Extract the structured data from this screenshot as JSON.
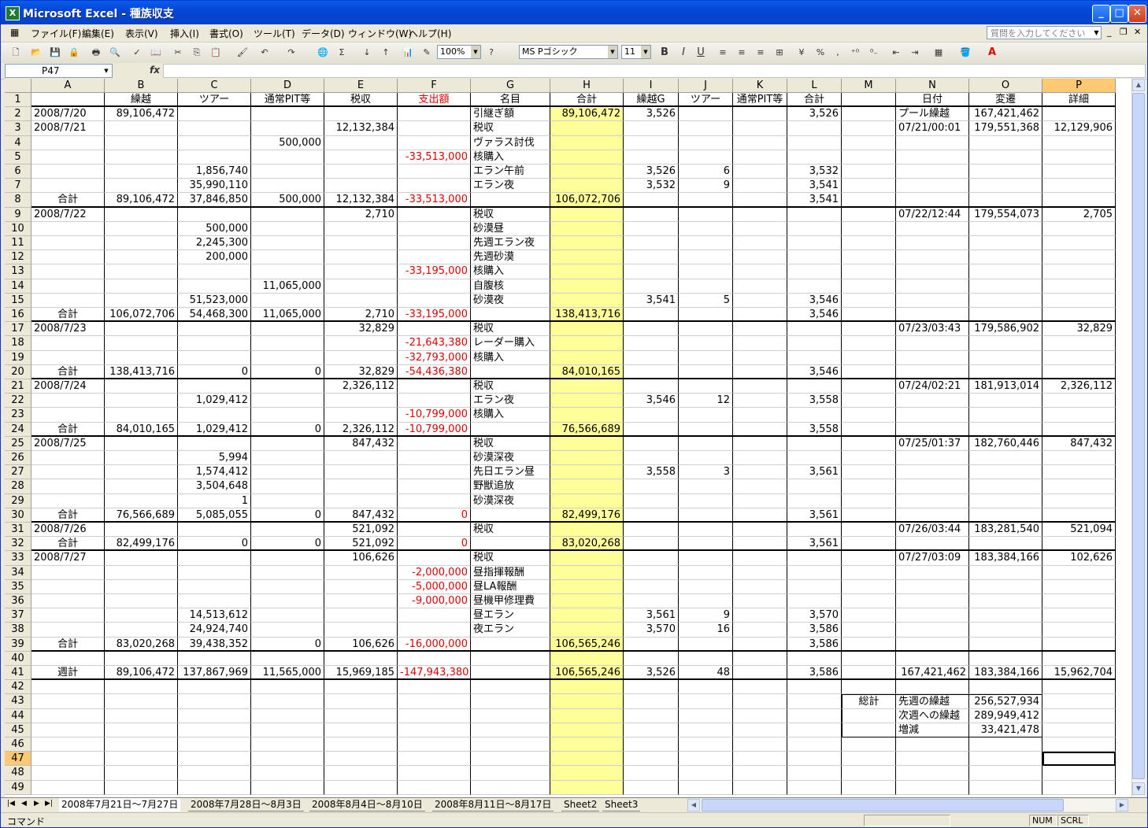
{
  "window": {
    "title": "Microsoft Excel - 種族収支",
    "app_icon": "X"
  },
  "menu": [
    "ファイル(F)",
    "編集(E)",
    "表示(V)",
    "挿入(I)",
    "書式(O)",
    "ツール(T)",
    "データ(D)",
    "ウィンドウ(W)",
    "ヘルプ(H)"
  ],
  "ask_placeholder": "質問を入力してください",
  "toolbar": {
    "zoom": "100%",
    "font": "MS Pゴシック",
    "size": "11",
    "bold": "B",
    "italic": "I",
    "underline": "U",
    "percent": "%",
    "comma": ",",
    "sum": "Σ"
  },
  "namebox": "P47",
  "fx": "fx",
  "columns": [
    {
      "id": "A",
      "w": 93
    },
    {
      "id": "B",
      "w": 93
    },
    {
      "id": "C",
      "w": 93
    },
    {
      "id": "D",
      "w": 93
    },
    {
      "id": "E",
      "w": 93
    },
    {
      "id": "F",
      "w": 93
    },
    {
      "id": "G",
      "w": 101
    },
    {
      "id": "H",
      "w": 93
    },
    {
      "id": "I",
      "w": 70
    },
    {
      "id": "J",
      "w": 69
    },
    {
      "id": "K",
      "w": 69
    },
    {
      "id": "L",
      "w": 69
    },
    {
      "id": "M",
      "w": 69
    },
    {
      "id": "N",
      "w": 93
    },
    {
      "id": "O",
      "w": 93
    },
    {
      "id": "P",
      "w": 93
    }
  ],
  "selected_col": "P",
  "selected_row": 47,
  "rows": [
    {
      "n": 1,
      "cells": {
        "B": "繰越",
        "C": "ツアー",
        "D": "通常PIT等",
        "E": "税収",
        "F": "支出額",
        "G": "名目",
        "H": "合計",
        "I": "繰越G",
        "J": "ツアー",
        "K": "通常PIT等",
        "L": "合計",
        "N": "日付",
        "O": "変遷",
        "P": "詳細"
      }
    },
    {
      "n": 2,
      "cells": {
        "A": "2008/7/20",
        "B": "89,106,472",
        "G": "引継ぎ額",
        "H": "89,106,472",
        "I": "3,526",
        "L": "3,526",
        "N": "プール繰越",
        "O": "167,421,462"
      }
    },
    {
      "n": 3,
      "cells": {
        "A": "2008/7/21",
        "E": "12,132,384",
        "G": "税収",
        "N": "07/21/00:01",
        "O": "179,551,368",
        "P": "12,129,906"
      }
    },
    {
      "n": 4,
      "cells": {
        "D": "500,000",
        "G": "ヴァラス討伐"
      }
    },
    {
      "n": 5,
      "cells": {
        "F": "-33,513,000",
        "G": "核購入"
      }
    },
    {
      "n": 6,
      "cells": {
        "C": "1,856,740",
        "G": "エラン午前",
        "I": "3,526",
        "J": "6",
        "L": "3,532"
      }
    },
    {
      "n": 7,
      "cells": {
        "C": "35,990,110",
        "G": "エラン夜",
        "I": "3,532",
        "J": "9",
        "L": "3,541"
      }
    },
    {
      "n": 8,
      "cells": {
        "A": "合計",
        "B": "89,106,472",
        "C": "37,846,850",
        "D": "500,000",
        "E": "12,132,384",
        "F": "-33,513,000",
        "H": "106,072,706",
        "L": "3,541"
      }
    },
    {
      "n": 9,
      "cells": {
        "A": "2008/7/22",
        "E": "2,710",
        "G": "税収",
        "N": "07/22/12:44",
        "O": "179,554,073",
        "P": "2,705"
      }
    },
    {
      "n": 10,
      "cells": {
        "C": "500,000",
        "G": "砂漠昼"
      }
    },
    {
      "n": 11,
      "cells": {
        "C": "2,245,300",
        "G": "先週エラン夜"
      }
    },
    {
      "n": 12,
      "cells": {
        "C": "200,000",
        "G": "先週砂漠"
      }
    },
    {
      "n": 13,
      "cells": {
        "F": "-33,195,000",
        "G": "核購入"
      }
    },
    {
      "n": 14,
      "cells": {
        "D": "11,065,000",
        "G": "自腹核"
      }
    },
    {
      "n": 15,
      "cells": {
        "C": "51,523,000",
        "G": "砂漠夜",
        "I": "3,541",
        "J": "5",
        "L": "3,546"
      }
    },
    {
      "n": 16,
      "cells": {
        "A": "合計",
        "B": "106,072,706",
        "C": "54,468,300",
        "D": "11,065,000",
        "E": "2,710",
        "F": "-33,195,000",
        "H": "138,413,716",
        "L": "3,546"
      }
    },
    {
      "n": 17,
      "cells": {
        "A": "2008/7/23",
        "E": "32,829",
        "G": "税収",
        "N": "07/23/03:43",
        "O": "179,586,902",
        "P": "32,829"
      }
    },
    {
      "n": 18,
      "cells": {
        "F": "-21,643,380",
        "G": "レーダー購入"
      }
    },
    {
      "n": 19,
      "cells": {
        "F": "-32,793,000",
        "G": "核購入"
      }
    },
    {
      "n": 20,
      "cells": {
        "A": "合計",
        "B": "138,413,716",
        "C": "0",
        "D": "0",
        "E": "32,829",
        "F": "-54,436,380",
        "H": "84,010,165",
        "L": "3,546"
      }
    },
    {
      "n": 21,
      "cells": {
        "A": "2008/7/24",
        "E": "2,326,112",
        "G": "税収",
        "N": "07/24/02:21",
        "O": "181,913,014",
        "P": "2,326,112"
      }
    },
    {
      "n": 22,
      "cells": {
        "C": "1,029,412",
        "G": "エラン夜",
        "I": "3,546",
        "J": "12",
        "L": "3,558"
      }
    },
    {
      "n": 23,
      "cells": {
        "F": "-10,799,000",
        "G": "核購入"
      }
    },
    {
      "n": 24,
      "cells": {
        "A": "合計",
        "B": "84,010,165",
        "C": "1,029,412",
        "D": "0",
        "E": "2,326,112",
        "F": "-10,799,000",
        "H": "76,566,689",
        "L": "3,558"
      }
    },
    {
      "n": 25,
      "cells": {
        "A": "2008/7/25",
        "E": "847,432",
        "G": "税収",
        "N": "07/25/01:37",
        "O": "182,760,446",
        "P": "847,432"
      }
    },
    {
      "n": 26,
      "cells": {
        "C": "5,994",
        "G": "砂漠深夜"
      }
    },
    {
      "n": 27,
      "cells": {
        "C": "1,574,412",
        "G": "先日エラン昼",
        "I": "3,558",
        "J": "3",
        "L": "3,561"
      }
    },
    {
      "n": 28,
      "cells": {
        "C": "3,504,648",
        "G": "野獣追放"
      }
    },
    {
      "n": 29,
      "cells": {
        "C": "1",
        "G": "砂漠深夜"
      }
    },
    {
      "n": 30,
      "cells": {
        "A": "合計",
        "B": "76,566,689",
        "C": "5,085,055",
        "D": "0",
        "E": "847,432",
        "F": "0",
        "H": "82,499,176",
        "L": "3,561"
      }
    },
    {
      "n": 31,
      "cells": {
        "A": "2008/7/26",
        "E": "521,092",
        "G": "税収",
        "N": "07/26/03:44",
        "O": "183,281,540",
        "P": "521,094"
      }
    },
    {
      "n": 32,
      "cells": {
        "A": "合計",
        "B": "82,499,176",
        "C": "0",
        "D": "0",
        "E": "521,092",
        "F": "0",
        "H": "83,020,268",
        "L": "3,561"
      }
    },
    {
      "n": 33,
      "cells": {
        "A": "2008/7/27",
        "E": "106,626",
        "G": "税収",
        "N": "07/27/03:09",
        "O": "183,384,166",
        "P": "102,626"
      }
    },
    {
      "n": 34,
      "cells": {
        "F": "-2,000,000",
        "G": "昼指揮報酬"
      }
    },
    {
      "n": 35,
      "cells": {
        "F": "-5,000,000",
        "G": "昼LA報酬"
      }
    },
    {
      "n": 36,
      "cells": {
        "F": "-9,000,000",
        "G": "昼機甲修理費"
      }
    },
    {
      "n": 37,
      "cells": {
        "C": "14,513,612",
        "G": "昼エラン",
        "I": "3,561",
        "J": "9",
        "L": "3,570"
      }
    },
    {
      "n": 38,
      "cells": {
        "C": "24,924,740",
        "G": "夜エラン",
        "I": "3,570",
        "J": "16",
        "L": "3,586"
      }
    },
    {
      "n": 39,
      "cells": {
        "A": "合計",
        "B": "83,020,268",
        "C": "39,438,352",
        "D": "0",
        "E": "106,626",
        "F": "-16,000,000",
        "H": "106,565,246",
        "L": "3,586"
      }
    },
    {
      "n": 40,
      "cells": {}
    },
    {
      "n": 41,
      "cells": {
        "A": "週計",
        "B": "89,106,472",
        "C": "137,867,969",
        "D": "11,565,000",
        "E": "15,969,185",
        "F": "-147,943,380",
        "H": "106,565,246",
        "I": "3,526",
        "J": "48",
        "L": "3,586",
        "N": "167,421,462",
        "O": "183,384,166",
        "P": "15,962,704"
      }
    },
    {
      "n": 42,
      "cells": {}
    },
    {
      "n": 43,
      "cells": {
        "M": "総計",
        "N": "先週の繰越",
        "O": "256,527,934"
      }
    },
    {
      "n": 44,
      "cells": {
        "N": "次週への繰越",
        "O": "289,949,412"
      }
    },
    {
      "n": 45,
      "cells": {
        "N": "増減",
        "O": "33,421,478"
      }
    },
    {
      "n": 46,
      "cells": {}
    },
    {
      "n": 47,
      "cells": {}
    },
    {
      "n": 48,
      "cells": {}
    },
    {
      "n": 49,
      "cells": {}
    }
  ],
  "tabs": [
    "2008年7月21日～7月27日",
    "2008年7月28日～8月3日",
    "2008年8月4日～8月10日",
    "2008年8月11日～8月17日",
    "Sheet2",
    "Sheet3"
  ],
  "active_tab": 0,
  "status": {
    "mode": "コマンド",
    "num": "NUM",
    "scrl": "SCRL"
  },
  "colors": {
    "highlight": "#ffff99",
    "negative": "#e00000",
    "selected_header": "#ffc973"
  }
}
